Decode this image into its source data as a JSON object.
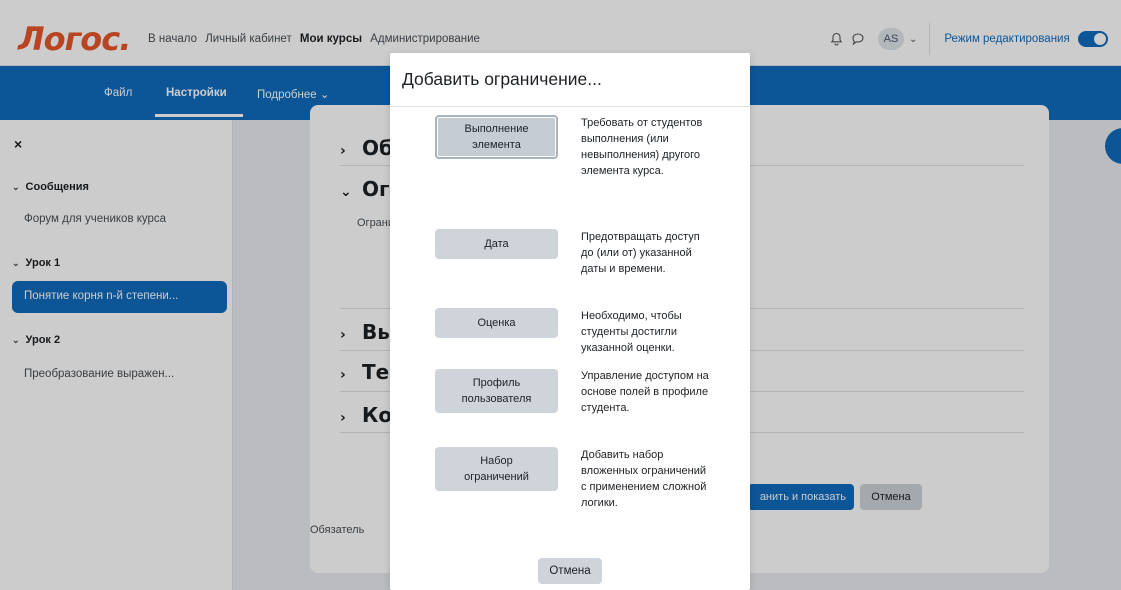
{
  "brand": {
    "logo": "Логос."
  },
  "top_nav": {
    "items": [
      "В начало",
      "Личный кабинет",
      "Мои курсы",
      "Администрирование"
    ]
  },
  "user": {
    "initials": "AS",
    "edit_mode_label": "Режим редактирования",
    "edit_mode_on": true
  },
  "secondary_nav": {
    "items": [
      "Файл",
      "Настройки",
      "Подробнее ⌄"
    ],
    "active": "Настройки"
  },
  "drawer": {
    "close": "×",
    "sections": [
      {
        "title": "Сообщения",
        "items": [
          "Форум для учеников курса"
        ]
      },
      {
        "title": "Урок 1",
        "items": [
          "Понятие корня n-й степени..."
        ]
      },
      {
        "title": "Урок 2",
        "items": [
          "Преобразование выражен..."
        ]
      }
    ]
  },
  "page": {
    "sections": [
      "Об",
      "Ог",
      "Вы",
      "Те",
      "Ко"
    ],
    "restriction_text": "Ограни",
    "required_text": "Обязатель",
    "save_button": "анить и показать",
    "cancel_button": "Отмена"
  },
  "modal": {
    "title": "Добавить ограничение...",
    "options": [
      {
        "button": "Выполнение элемента",
        "description": "Требовать от студентов выполнения (или невыполнения) другого элемента курса."
      },
      {
        "button": "Дата",
        "description": "Предотвращать доступ до (или от) указанной даты и времени."
      },
      {
        "button": "Оценка",
        "description": "Необходимо, чтобы студенты достигли указанной оценки."
      },
      {
        "button": "Профиль пользователя",
        "description": "Управление доступом на основе полей в профиле студента."
      },
      {
        "button": "Набор ограничений",
        "description": "Добавить набор вложенных ограничений с применением сложной логики."
      }
    ],
    "cancel": "Отмена"
  }
}
